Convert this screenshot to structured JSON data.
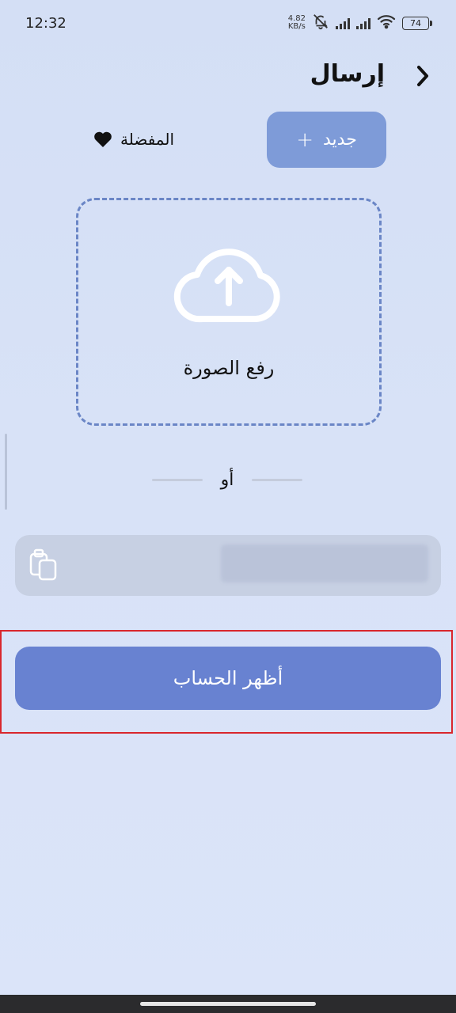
{
  "status_bar": {
    "time": "12:32",
    "net_speed_value": "4.82",
    "net_speed_unit": "KB/s",
    "battery": "74",
    "icons": [
      "bell-muted-icon",
      "signal-icon",
      "signal-icon",
      "wifi-icon",
      "battery-icon"
    ]
  },
  "header": {
    "title": "إرسال",
    "back_icon": "chevron-right-icon"
  },
  "actions": {
    "new_label": "جديد",
    "new_icon": "plus-icon",
    "favorites_label": "المفضلة",
    "favorites_icon": "heart-icon"
  },
  "upload": {
    "label": "رفع الصورة",
    "icon": "cloud-upload-icon"
  },
  "divider": {
    "or_text": "أو"
  },
  "paste_field": {
    "icon": "clipboard-icon",
    "value": ""
  },
  "primary_button": {
    "label": "أظهر الحساب"
  },
  "colors": {
    "primary": "#6882d1",
    "secondary": "#7e9bd8",
    "dashed_border": "#6b86c6",
    "highlight": "#d9262d",
    "background": "#d8e2f7"
  }
}
